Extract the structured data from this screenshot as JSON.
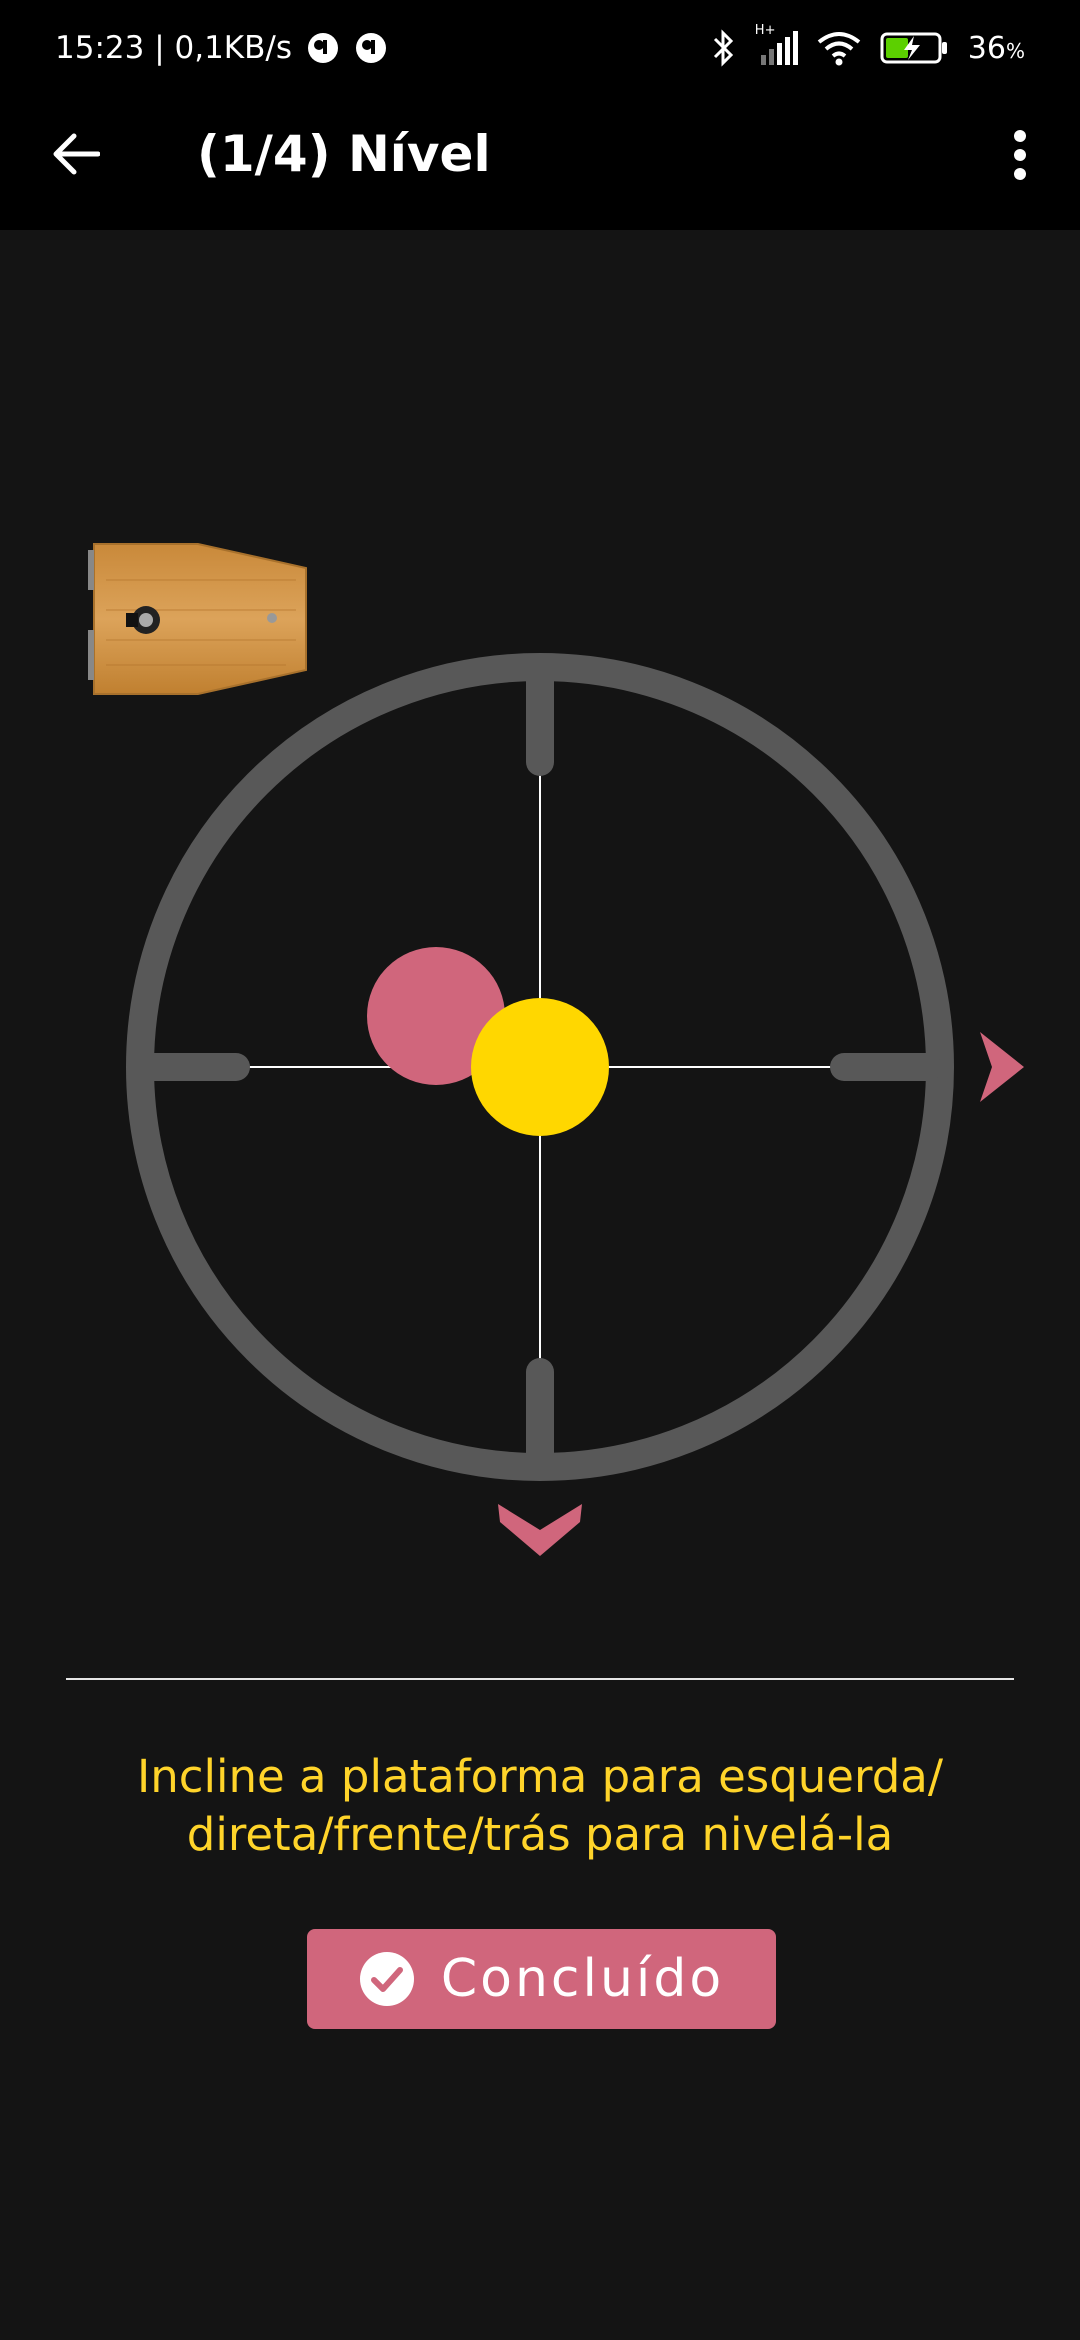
{
  "status_bar": {
    "time": "15:23",
    "speed": "0,1KB/s",
    "network": "H+",
    "battery_percent": "36",
    "battery_unit": "%"
  },
  "app_bar": {
    "title": "(1/4) Nível",
    "back_icon": "arrow-left-icon",
    "menu_icon": "more-vert-icon"
  },
  "level": {
    "bubble_color": "#d0667c",
    "target_color": "#ffd700",
    "ring_color": "#585858",
    "hint_right_icon": "chevron-right-icon",
    "hint_down_icon": "chevron-down-icon"
  },
  "instruction": {
    "line1": "Incline a plataforma para esquerda/",
    "line2": "direta/frente/trás para nivelá-la"
  },
  "done_button": {
    "label": "Concluído",
    "icon": "check-circle-icon"
  }
}
